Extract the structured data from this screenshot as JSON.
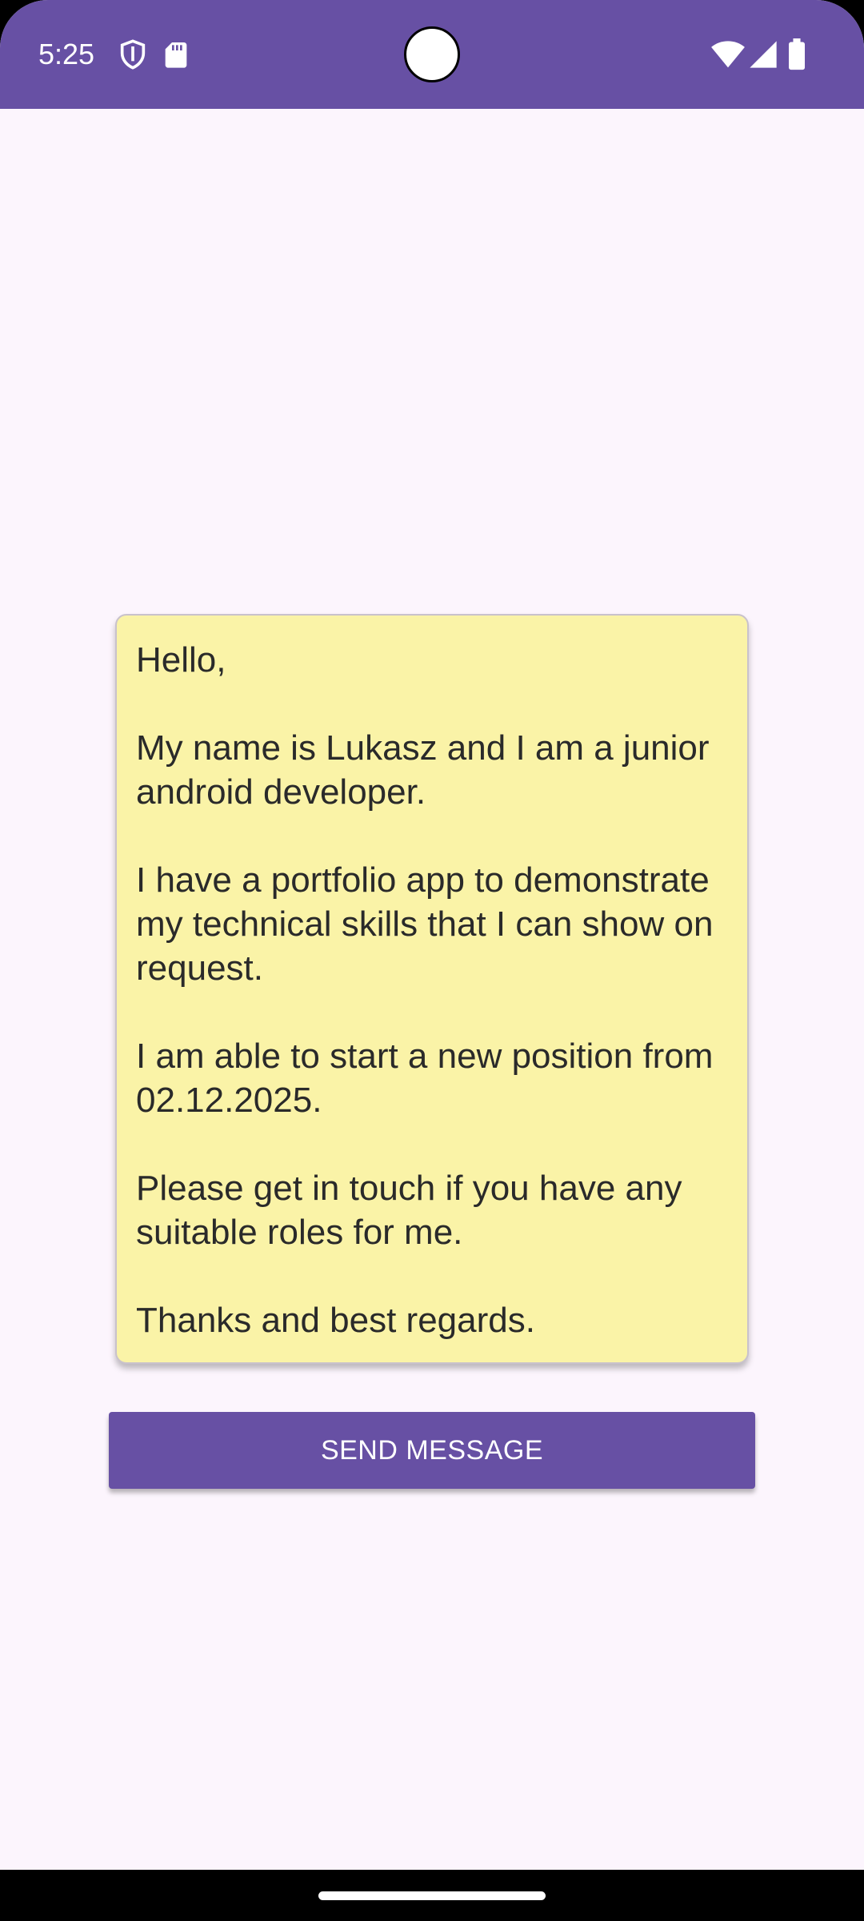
{
  "status_bar": {
    "time": "5:25",
    "icons_left": [
      "shield-icon",
      "sd-card-icon"
    ],
    "icons_right": [
      "wifi-icon",
      "cellular-signal-icon",
      "battery-icon"
    ],
    "background_color": "#6750a4"
  },
  "message": {
    "text": "Hello,\n\nMy name is Lukasz and I am a junior android developer.\n\nI have a portfolio app to demonstrate my technical skills that I can show on request.\n\nI am able to start a new position from 02.12.2025.\n\nPlease get in touch if you have any suitable roles for me.\n\nThanks and best regards.",
    "background_color": "#faf3a7"
  },
  "send_button": {
    "label": "SEND MESSAGE",
    "color": "#6750a4"
  },
  "navigation": {
    "handle": "home-gesture-handle"
  }
}
